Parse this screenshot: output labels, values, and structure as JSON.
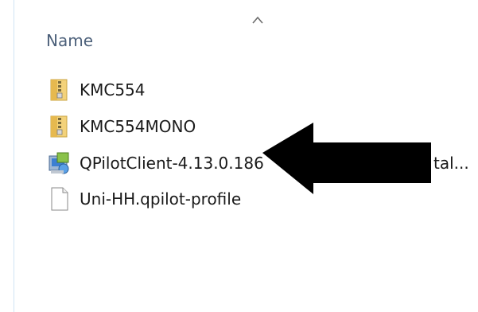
{
  "header": {
    "column_name": "Name"
  },
  "files": [
    {
      "name": "KMC554",
      "icon": "zip-folder-icon"
    },
    {
      "name": "KMC554MONO",
      "icon": "zip-folder-icon"
    },
    {
      "name": "QPilotClient-4.13.0.186",
      "name_suffix": "tal...",
      "icon": "installer-icon"
    },
    {
      "name": "Uni-HH.qpilot-profile",
      "icon": "document-icon"
    }
  ],
  "colors": {
    "header_text": "#4c607a",
    "item_text": "#1a1a1a",
    "zip_folder": "#e8c46a",
    "annotation_arrow": "#000000"
  }
}
